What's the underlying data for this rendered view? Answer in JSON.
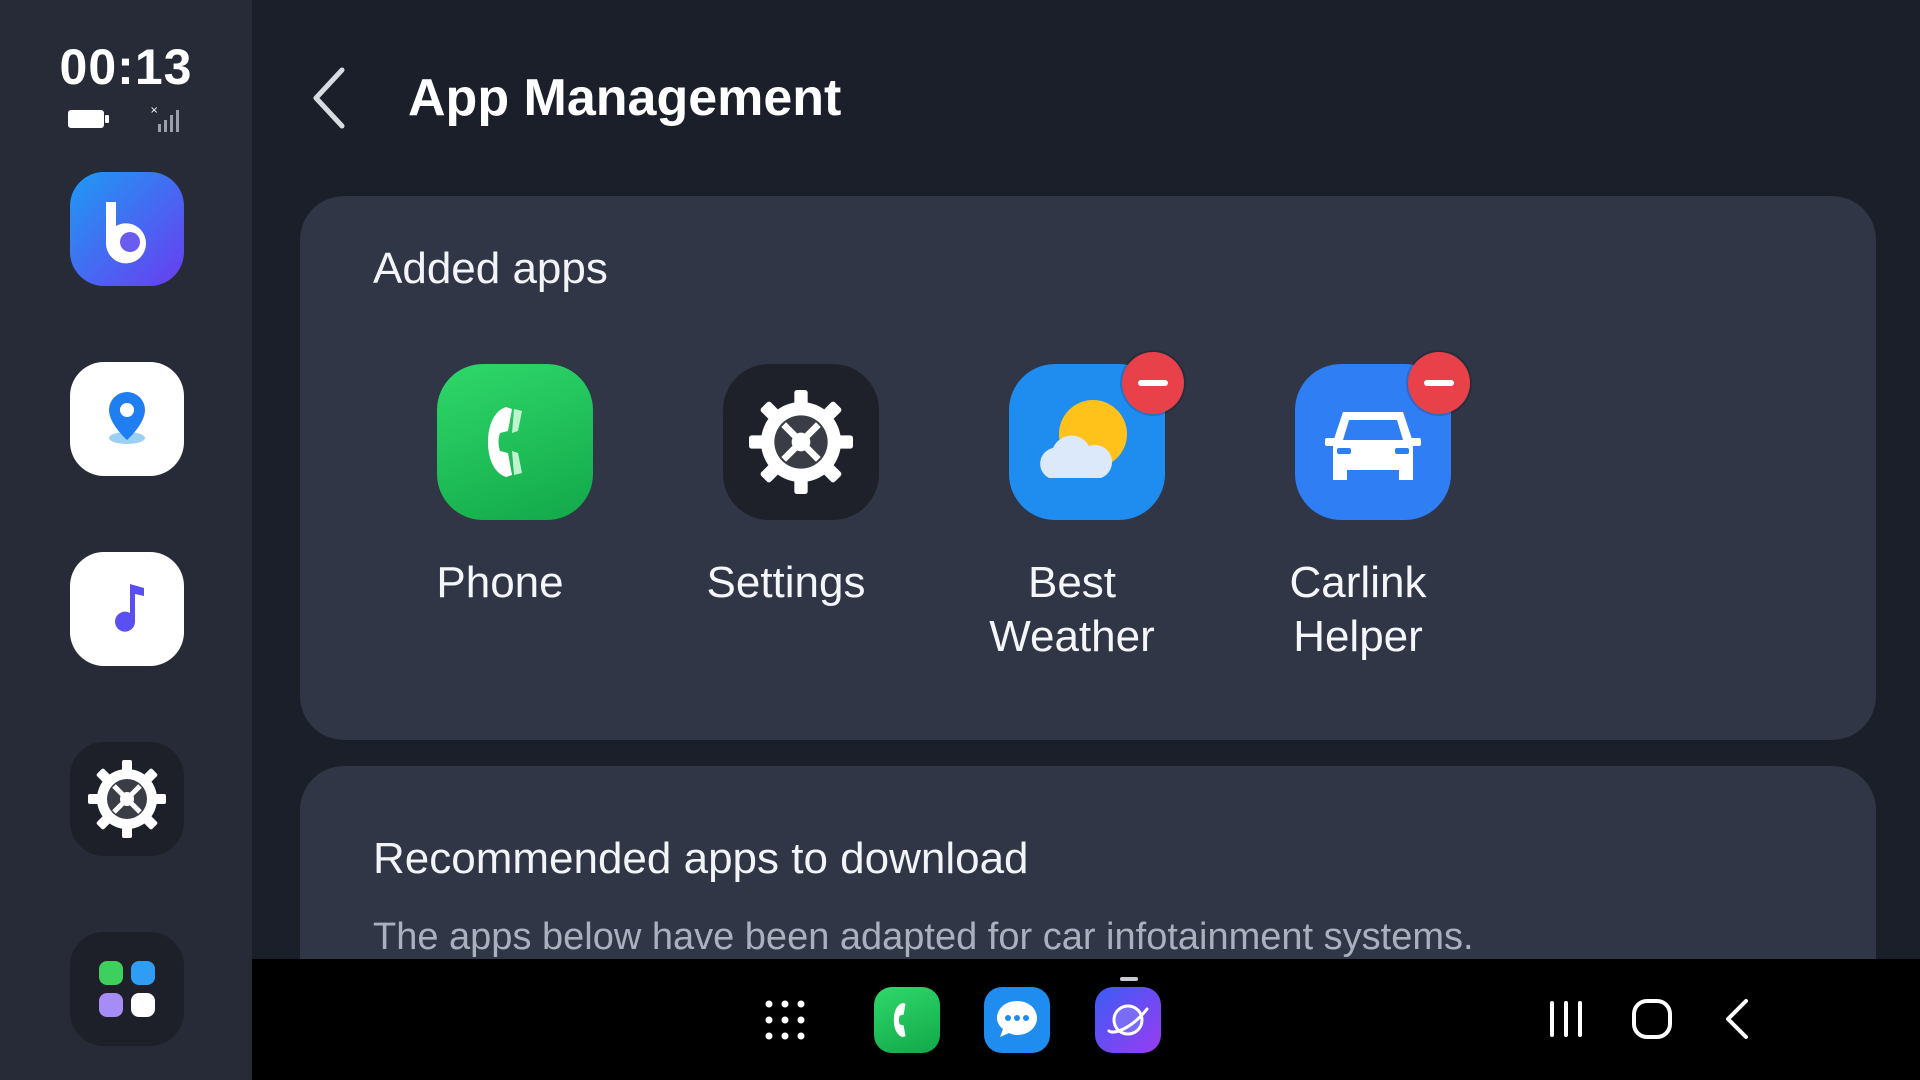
{
  "status": {
    "time": "00:13"
  },
  "header": {
    "title": "App Management"
  },
  "added_apps": {
    "heading": "Added apps",
    "apps": [
      {
        "label": "Phone",
        "removable": false,
        "color": "#1fc45a",
        "icon": "phone-icon"
      },
      {
        "label": "Settings",
        "removable": false,
        "color": "#23262e",
        "icon": "gear-icon"
      },
      {
        "label": "Best\nWeather",
        "removable": true,
        "color": "#1f8cf0",
        "icon": "weather-icon"
      },
      {
        "label": "Carlink\nHelper",
        "removable": true,
        "color": "#2f7ef4",
        "icon": "car-icon"
      }
    ]
  },
  "recommended": {
    "heading": "Recommended apps to download",
    "description": "The apps below have been adapted for car infotainment systems."
  },
  "sidebar": {
    "apps": [
      "assistant-icon",
      "location-pin-icon",
      "music-note-icon",
      "gear-icon",
      "app-grid-icon"
    ]
  },
  "dock": {
    "apps": [
      "app-drawer-icon",
      "phone-icon",
      "messages-icon",
      "internet-browser-icon"
    ]
  },
  "nav": [
    "recents-icon",
    "home-icon",
    "back-icon"
  ],
  "colors": {
    "remove_badge": "#e8414a",
    "card": "#303645",
    "sidebar": "#272b37"
  }
}
